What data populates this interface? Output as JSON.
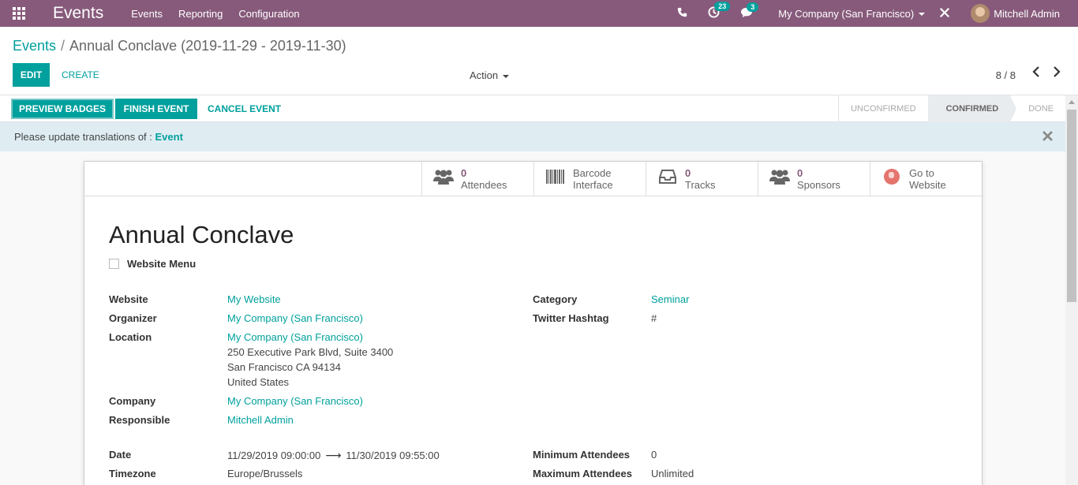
{
  "navbar": {
    "app_title": "Events",
    "menu": [
      "Events",
      "Reporting",
      "Configuration"
    ],
    "activity_count": "23",
    "message_count": "3",
    "company": "My Company (San Francisco)",
    "user": "Mitchell Admin"
  },
  "breadcrumb": {
    "parent": "Events",
    "separator": "/",
    "current": "Annual Conclave (2019-11-29 - 2019-11-30)"
  },
  "control": {
    "edit": "EDIT",
    "create": "CREATE",
    "action": "Action",
    "pager": "8 / 8"
  },
  "statusbar": {
    "preview_badges": "PREVIEW BADGES",
    "finish_event": "FINISH EVENT",
    "cancel_event": "CANCEL EVENT",
    "stages": [
      "UNCONFIRMED",
      "CONFIRMED",
      "DONE"
    ],
    "active_stage": "CONFIRMED"
  },
  "alert": {
    "text": "Please update translations of :",
    "link": "Event"
  },
  "smart_buttons": {
    "attendees": {
      "count": "0",
      "label": "Attendees"
    },
    "barcode": {
      "line1": "Barcode",
      "line2": "Interface"
    },
    "tracks": {
      "count": "0",
      "label": "Tracks"
    },
    "sponsors": {
      "count": "0",
      "label": "Sponsors"
    },
    "website": {
      "line1": "Go to",
      "line2": "Website"
    }
  },
  "event": {
    "name": "Annual Conclave",
    "website_menu_label": "Website Menu",
    "fields": {
      "website": {
        "label": "Website",
        "value": "My Website"
      },
      "organizer": {
        "label": "Organizer",
        "value": "My Company (San Francisco)"
      },
      "location": {
        "label": "Location",
        "value": "My Company (San Francisco)",
        "address1": "250 Executive Park Blvd, Suite 3400",
        "address2": "San Francisco CA 94134",
        "address3": "United States"
      },
      "company": {
        "label": "Company",
        "value": "My Company (San Francisco)"
      },
      "responsible": {
        "label": "Responsible",
        "value": "Mitchell Admin"
      },
      "date": {
        "label": "Date",
        "start": "11/29/2019 09:00:00",
        "end": "11/30/2019 09:55:00"
      },
      "timezone": {
        "label": "Timezone",
        "value": "Europe/Brussels"
      },
      "category": {
        "label": "Category",
        "value": "Seminar"
      },
      "twitter": {
        "label": "Twitter Hashtag",
        "value": "#"
      },
      "min_attendees": {
        "label": "Minimum Attendees",
        "value": "0"
      },
      "max_attendees": {
        "label": "Maximum Attendees",
        "value": "Unlimited"
      }
    }
  },
  "colors": {
    "brand": "#875a7b",
    "accent": "#00a09d"
  }
}
